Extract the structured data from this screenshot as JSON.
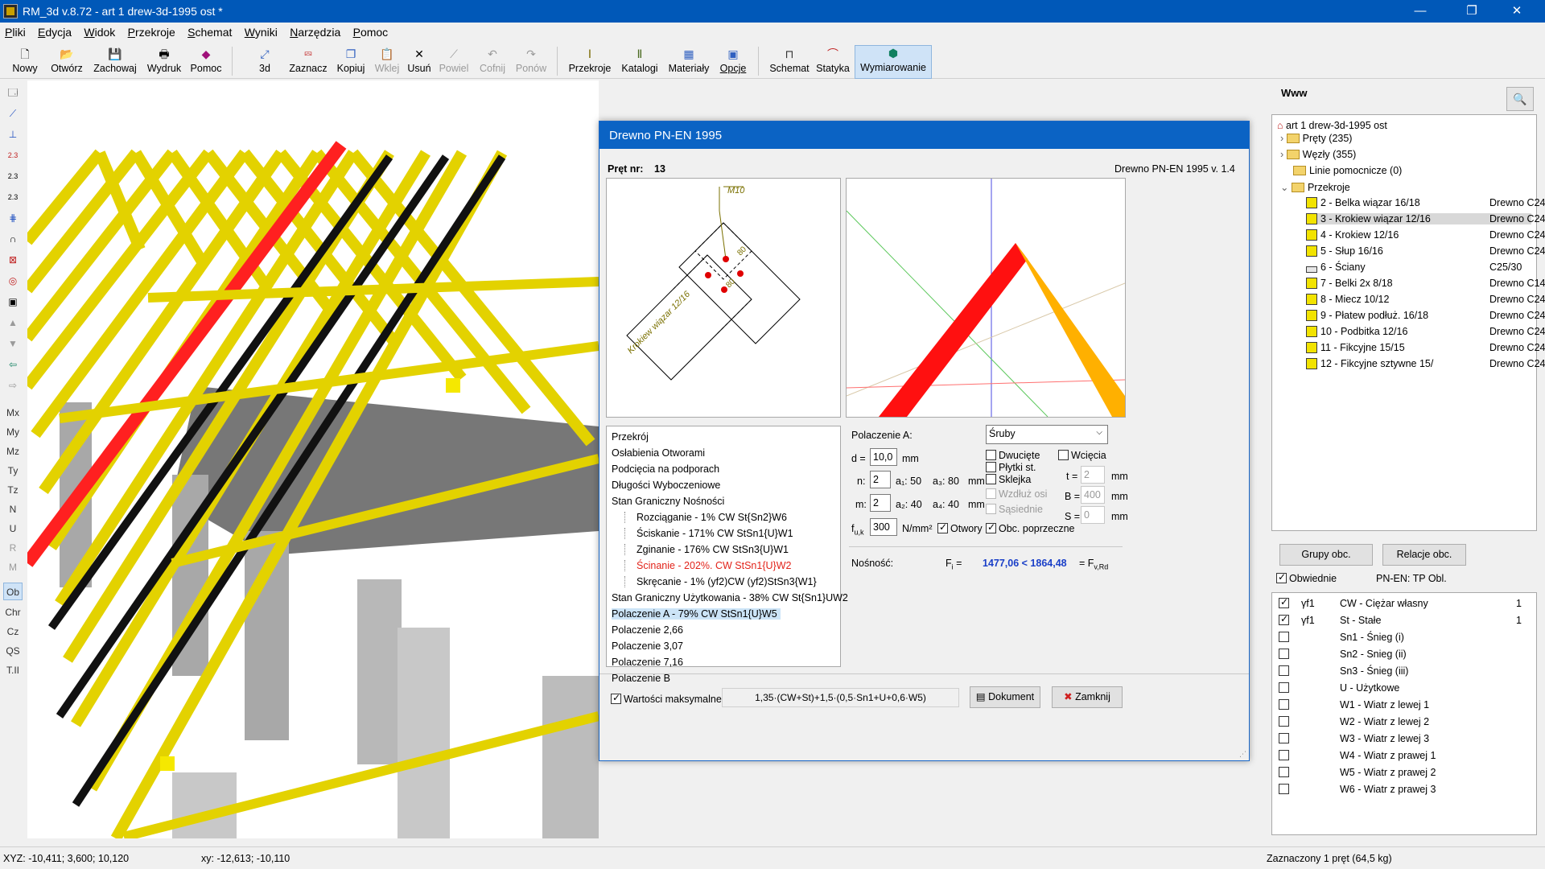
{
  "window": {
    "title": "RM_3d v.8.72 - art 1 drew-3d-1995 ost *",
    "min": "—",
    "max": "❐",
    "close": "✕"
  },
  "menu": [
    "Pliki",
    "Edycja",
    "Widok",
    "Przekroje",
    "Schemat",
    "Wyniki",
    "Narzędzia",
    "Pomoc"
  ],
  "toolbar": {
    "nowy": "Nowy",
    "otworz": "Otwórz",
    "zachowaj": "Zachowaj",
    "wydruk": "Wydruk",
    "pomoc": "Pomoc",
    "v3d": "3d",
    "zaznacz": "Zaznacz",
    "kopiuj": "Kopiuj",
    "wklej": "Wklej",
    "usun": "Usuń",
    "powiel": "Powiel",
    "cofnij": "Cofnij",
    "ponow": "Ponów",
    "przekroje": "Przekroje",
    "katalogi": "Katalogi",
    "materialy": "Materiały",
    "opcje": "Opcje",
    "schemat": "Schemat",
    "statyka": "Statyka",
    "wymiarowanie": "Wymiarowanie"
  },
  "left_tools": {
    "mx": "Mx",
    "my": "My",
    "mz": "Mz",
    "ty": "Ty",
    "tz": "Tz",
    "n": "N",
    "u": "U",
    "r": "R",
    "m": "M",
    "ob": "Ob",
    "chr": "Chr",
    "cz": "Cz",
    "qs": "QS",
    "ti": "T.II"
  },
  "dialog": {
    "title": "Drewno PN-EN 1995",
    "bar_label": "Pręt nr:",
    "bar_number": "13",
    "version": "Drewno PN-EN 1995 v. 1.4",
    "sketch": {
      "bolt": "M10",
      "dim1": "80",
      "dim2": "80",
      "member": "Krokiew wiązar 12/16"
    },
    "checks": [
      {
        "text": "Przekrój",
        "indent": 0,
        "color": "normal"
      },
      {
        "text": "Osłabienia Otworami",
        "indent": 0,
        "color": "normal"
      },
      {
        "text": "Podcięcia na podporach",
        "indent": 0,
        "color": "normal"
      },
      {
        "text": "Długości Wyboczeniowe",
        "indent": 0,
        "color": "normal"
      },
      {
        "text": "Stan Graniczny Nośności",
        "indent": 0,
        "color": "normal"
      },
      {
        "text": "Rozciąganie - 1%     CW St{Sn2}W6",
        "indent": 1,
        "color": "normal"
      },
      {
        "text": "Ściskanie - 171%     CW StSn1{U}W1",
        "indent": 1,
        "color": "normal"
      },
      {
        "text": "Zginanie - 176%     CW StSn3{U}W1",
        "indent": 1,
        "color": "normal"
      },
      {
        "text": "Ścinanie - 202%.     CW StSn1{U}W2",
        "indent": 1,
        "color": "red"
      },
      {
        "text": "Skręcanie - 1%     (yf2)CW (yf2)StSn3{W1}",
        "indent": 1,
        "color": "normal"
      },
      {
        "text": "Stan Graniczny Użytkowania - 38%     CW St{Sn1}UW2",
        "indent": 0,
        "color": "normal"
      },
      {
        "text": "Polaczenie A - 79%     CW StSn1{U}W5",
        "indent": 0,
        "color": "selected"
      },
      {
        "text": "Polaczenie 2,66",
        "indent": 0,
        "color": "normal"
      },
      {
        "text": "Polaczenie 3,07",
        "indent": 0,
        "color": "normal"
      },
      {
        "text": "Polaczenie 7,16",
        "indent": 0,
        "color": "normal"
      },
      {
        "text": "Polaczenie B",
        "indent": 0,
        "color": "normal"
      }
    ],
    "conn": {
      "label": "Polaczenie A:",
      "type": "Śruby",
      "d_label": "d =",
      "d_value": "10,0",
      "d_unit": "mm",
      "n_label": "n:",
      "n_value": "2",
      "a1": "a₁:  50",
      "a3": "a₃:  80",
      "unit1": "mm",
      "m_label": "m:",
      "m_value": "2",
      "a2": "a₂:  40",
      "a4": "a₄:  40",
      "unit2": "mm",
      "fuk_label": "f",
      "fuk_sub": "u,k",
      "fuk_value": "300",
      "fuk_unit": "N/mm²",
      "otwory": "Otwory",
      "dwuciete": "Dwucięte",
      "plytki": "Płytki st.",
      "sklejka": "Sklejka",
      "wzdluz": "Wzdłuż osi",
      "sasiednie": "Sąsiednie",
      "obc": "Obc. poprzeczne",
      "wciecia": "Wcięcia",
      "t_label": "t =",
      "t_value": "2",
      "b_label": "B =",
      "b_value": "400",
      "s_label": "S =",
      "s_value": "0",
      "mm": "mm"
    },
    "nosnosc": {
      "label": "Nośność:",
      "fi": "F",
      "fi_sub": "i",
      "eq": "=",
      "value": "1477,06 < 1864,48",
      "rhs": "= F",
      "rhs_sub": "v,Rd"
    },
    "max_label": "Wartości maksymalne",
    "combination": "1,35·(CW+St)+1,5·(0,5·Sn1+U+0,6·W5)",
    "btn_doc": "Dokument",
    "btn_close": "Zamknij"
  },
  "right": {
    "title": "Www",
    "root": "art 1 drew-3d-1995 ost",
    "prety": "Pręty (235)",
    "wezly": "Węzły (355)",
    "linie": "Linie pomocnicze (0)",
    "przekroje": "Przekroje",
    "sections": [
      {
        "name": "2 - Belka wiązar 16/18",
        "mat": "Drewno C24"
      },
      {
        "name": "3 - Krokiew wiązar 12/16",
        "mat": "Drewno C24"
      },
      {
        "name": "4 - Krokiew 12/16",
        "mat": "Drewno C24"
      },
      {
        "name": "5 - Słup 16/16",
        "mat": "Drewno C24"
      },
      {
        "name": "6 - Ściany",
        "mat": "C25/30"
      },
      {
        "name": "7 - Belki 2x 8/18",
        "mat": "Drewno C14"
      },
      {
        "name": "8 - Miecz 10/12",
        "mat": "Drewno C24"
      },
      {
        "name": "9 - Płatew podłuż. 16/18",
        "mat": "Drewno C24"
      },
      {
        "name": "10 - Podbitka 12/16",
        "mat": "Drewno C24"
      },
      {
        "name": "11 - Fikcyjne 15/15",
        "mat": "Drewno C24"
      },
      {
        "name": "12 - Fikcyjne sztywne 15/",
        "mat": "Drewno C24"
      }
    ],
    "grupy": "Grupy obc.",
    "relacje": "Relacje obc.",
    "obwiednie": "Obwiednie",
    "pnen": "PN-EN:  TP Obl.",
    "cases": [
      {
        "checked": true,
        "gamma": "γf1",
        "name": "CW - Ciężar własny",
        "n": "1"
      },
      {
        "checked": true,
        "gamma": "γf1",
        "name": "St - Stałe",
        "n": "1"
      },
      {
        "checked": false,
        "gamma": "",
        "name": "Sn1 - Śnieg (i)",
        "n": ""
      },
      {
        "checked": false,
        "gamma": "",
        "name": "Sn2 - Snieg (ii)",
        "n": ""
      },
      {
        "checked": false,
        "gamma": "",
        "name": "Sn3 - Śnieg (iii)",
        "n": ""
      },
      {
        "checked": false,
        "gamma": "",
        "name": "U - Użytkowe",
        "n": ""
      },
      {
        "checked": false,
        "gamma": "",
        "name": "W1 - Wiatr z lewej 1",
        "n": ""
      },
      {
        "checked": false,
        "gamma": "",
        "name": "W2 - Wiatr z lewej 2",
        "n": ""
      },
      {
        "checked": false,
        "gamma": "",
        "name": "W3 - Wiatr z lewej 3",
        "n": ""
      },
      {
        "checked": false,
        "gamma": "",
        "name": "W4 - Wiatr z prawej 1",
        "n": ""
      },
      {
        "checked": false,
        "gamma": "",
        "name": "W5 - Wiatr z prawej 2",
        "n": ""
      },
      {
        "checked": false,
        "gamma": "",
        "name": "W6 - Wiatr z prawej 3",
        "n": ""
      }
    ]
  },
  "status": {
    "xyz": "XYZ: -10,411; 3,600; 10,120",
    "xy": "xy: -12,613; -10,110",
    "sel": "Zaznaczony 1 pręt    (64,5 kg)"
  }
}
